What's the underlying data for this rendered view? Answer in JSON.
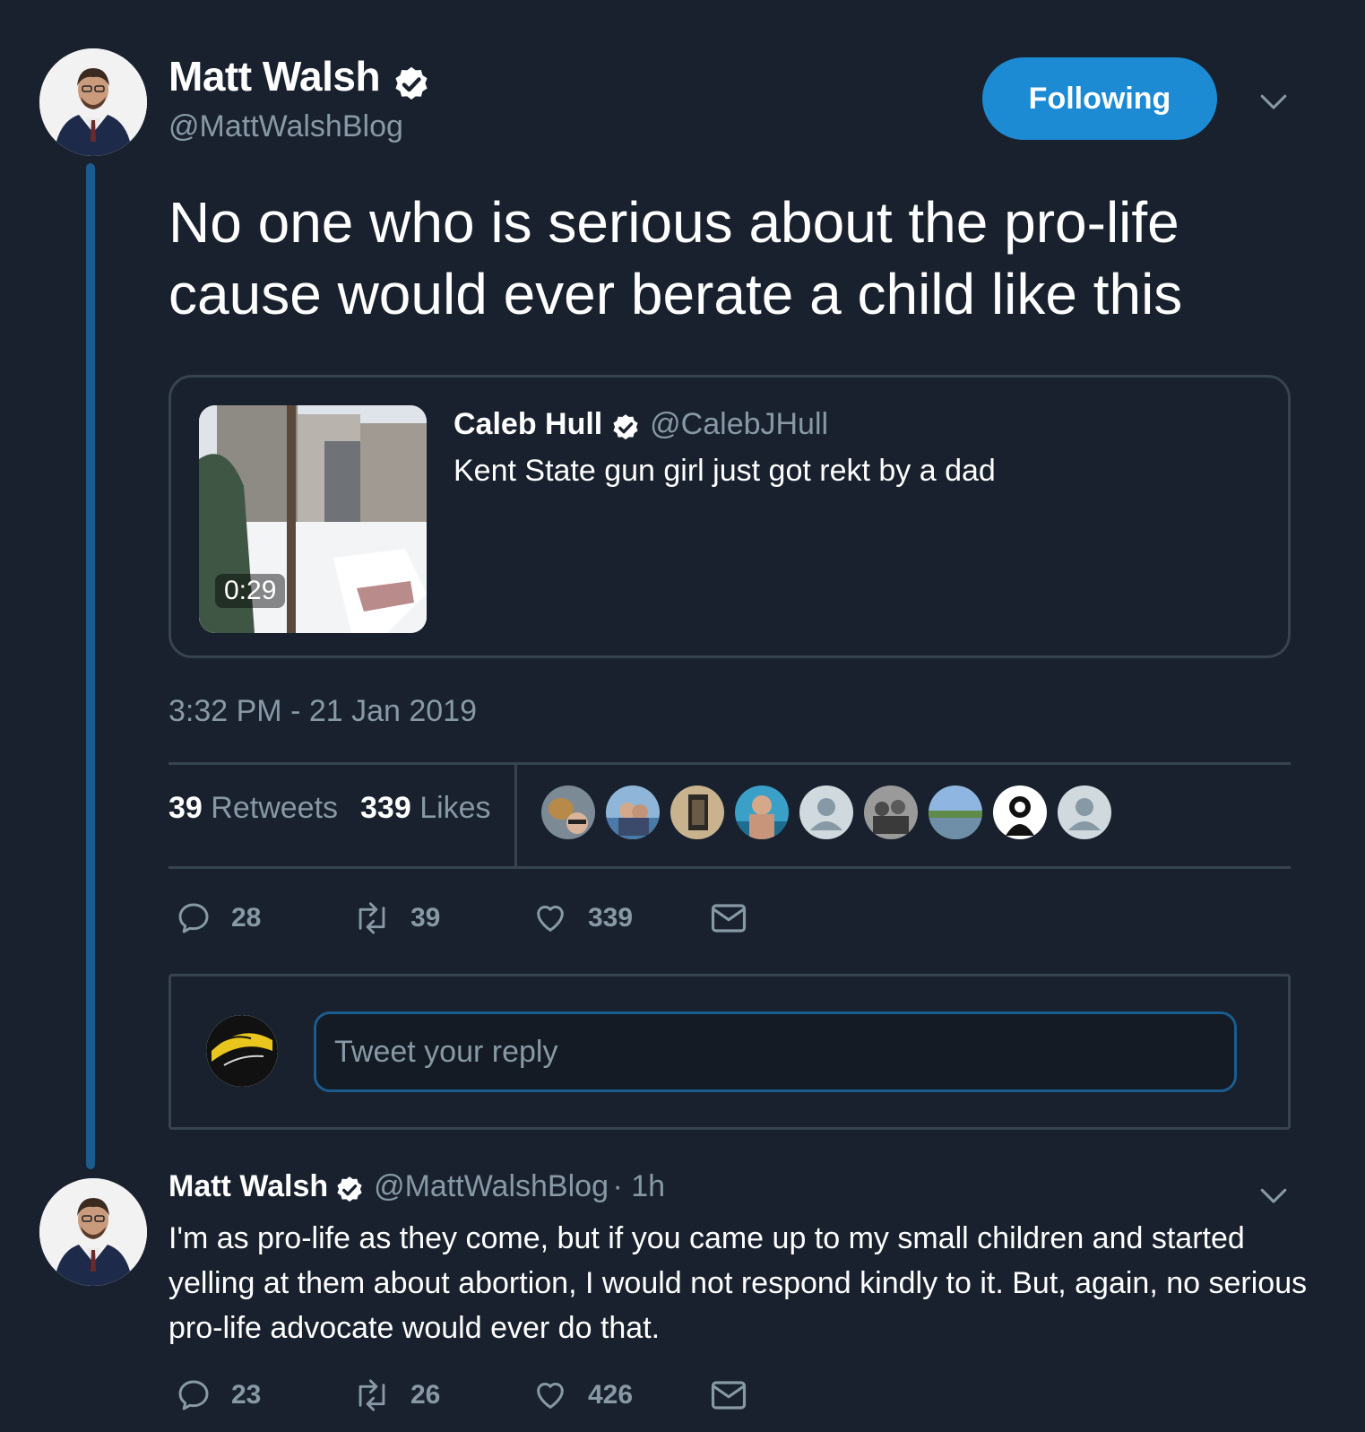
{
  "colors": {
    "background": "#18212d",
    "accent": "#1d8ad4",
    "muted_text": "#8899a6",
    "border": "#38444d",
    "thread_line": "#1b5c8f"
  },
  "main_tweet": {
    "author_name": "Matt Walsh",
    "author_handle": "@MattWalshBlog",
    "follow_button_label": "Following",
    "menu_icon": "chevron-down-icon",
    "text": "No one who is serious about the pro-life cause would ever berate a child like this",
    "timestamp": "3:32 PM - 21 Jan 2019",
    "quoted_tweet": {
      "author_name": "Caleb Hull",
      "author_handle": "@CalebJHull",
      "text": "Kent State gun girl just got rekt by a dad",
      "video_duration": "0:29"
    },
    "stats": {
      "retweets_count": "39",
      "retweets_label": "Retweets",
      "likes_count": "339",
      "likes_label": "Likes"
    },
    "actions": {
      "replies": "28",
      "retweets": "39",
      "likes": "339"
    }
  },
  "reply_composer": {
    "placeholder": "Tweet your reply"
  },
  "reply_tweet": {
    "author_name": "Matt Walsh",
    "author_handle": "@MattWalshBlog",
    "time": "· 1h",
    "text": "I'm as pro-life as they come, but if you came up to my small children and started yelling at them about abortion, I would not respond kindly to it. But, again, no serious pro-life advocate would ever do that.",
    "actions": {
      "replies": "23",
      "retweets": "26",
      "likes": "426"
    }
  }
}
